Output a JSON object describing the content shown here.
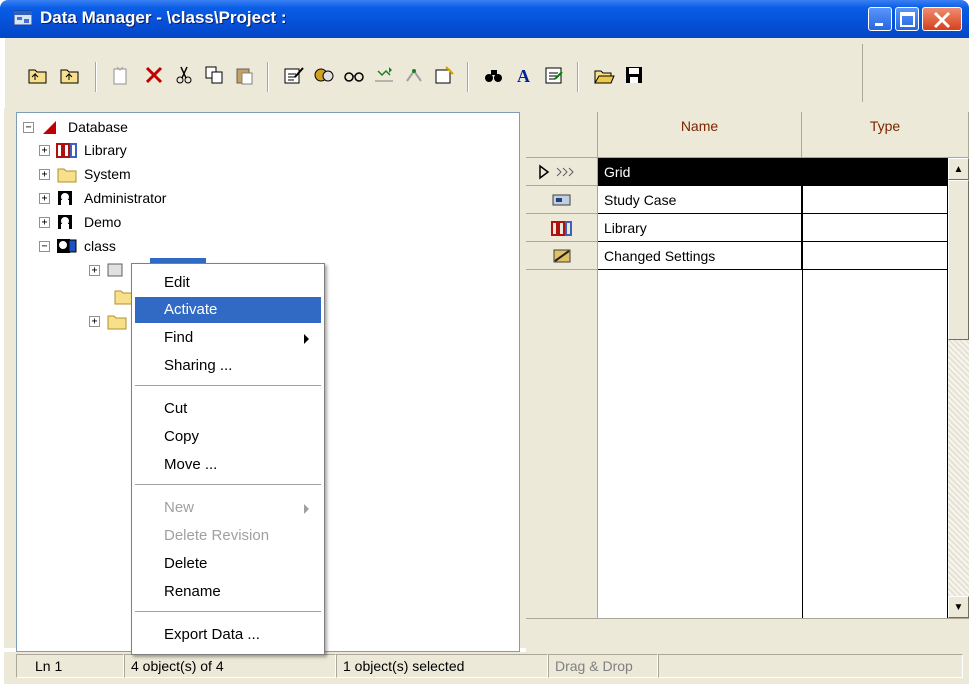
{
  "window": {
    "title": "Data Manager - \\class\\Project :"
  },
  "toolbar": {
    "buttons": [
      "up-folder",
      "up-level",
      "new-object",
      "delete",
      "cut",
      "copy",
      "paste",
      "edit",
      "activate",
      "show-references",
      "filter",
      "tree",
      "new-wizard",
      "find",
      "font",
      "print-edit",
      "open",
      "save"
    ]
  },
  "tree": {
    "root": {
      "label": "Database"
    },
    "items": [
      {
        "label": "Library"
      },
      {
        "label": "System"
      },
      {
        "label": "Administrator"
      },
      {
        "label": "Demo"
      },
      {
        "label": "class"
      }
    ]
  },
  "context_menu": {
    "items": [
      {
        "label": "Edit"
      },
      {
        "label": "Activate"
      },
      {
        "label": "Find"
      },
      {
        "label": "Sharing ..."
      },
      {
        "label": "Cut"
      },
      {
        "label": "Copy"
      },
      {
        "label": "Move ..."
      },
      {
        "label": "New"
      },
      {
        "label": "Delete Revision"
      },
      {
        "label": "Delete"
      },
      {
        "label": "Rename"
      },
      {
        "label": "Export Data ..."
      }
    ]
  },
  "grid": {
    "columns": {
      "name": "Name",
      "type": "Type"
    },
    "rows": [
      {
        "name": "Grid",
        "type": ""
      },
      {
        "name": "Study Case",
        "type": ""
      },
      {
        "name": "Library",
        "type": ""
      },
      {
        "name": "Changed Settings",
        "type": ""
      }
    ]
  },
  "status": {
    "line": "Ln 1",
    "objects": "4 object(s) of 4",
    "selected": "1 object(s) selected",
    "drag_drop": "Drag & Drop"
  },
  "colors": {
    "title_bar": "#0a5ee6",
    "highlight": "#316ac5",
    "header_text": "#7a2500",
    "library_icon": "#b01010"
  }
}
